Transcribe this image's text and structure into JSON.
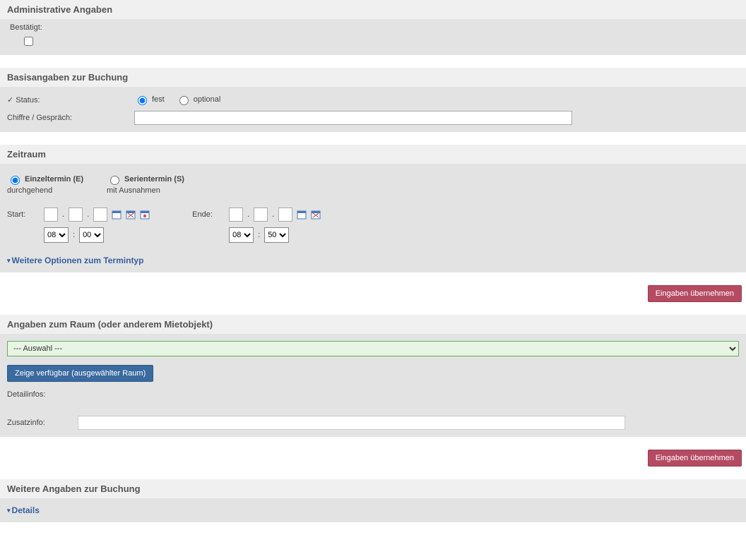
{
  "admin": {
    "heading": "Administrative Angaben",
    "confirmed_label": "Bestätigt:"
  },
  "basics": {
    "heading": "Basisangaben zur Buchung",
    "status_label": "✓ Status:",
    "status_fest": "fest",
    "status_optional": "optional",
    "chiffre_label": "Chiffre / Gespräch:"
  },
  "timerange": {
    "heading": "Zeitraum",
    "single_label": "Einzeltermin (E)",
    "single_hint": "durchgehend",
    "series_label": "Serientermin (S)",
    "series_hint": "mit Ausnahmen",
    "start_label": "Start:",
    "end_label": "Ende:",
    "hour_start": "08",
    "minute_start": "00",
    "hour_end": "08",
    "minute_end": "50",
    "more_options": "Weitere Optionen zum Termintyp"
  },
  "apply_button": "Eingaben übernehmen",
  "room": {
    "heading": "Angaben zum Raum (oder anderem Mietobjekt)",
    "select_placeholder": "--- Auswahl ---",
    "show_available": "Zeige verfügbar (ausgewählter Raum)",
    "detailinfo_label": "Detailinfos:",
    "zusatzinfo_label": "Zusatzinfo:"
  },
  "further": {
    "heading": "Weitere Angaben zur Buchung",
    "details_link": "Details"
  }
}
